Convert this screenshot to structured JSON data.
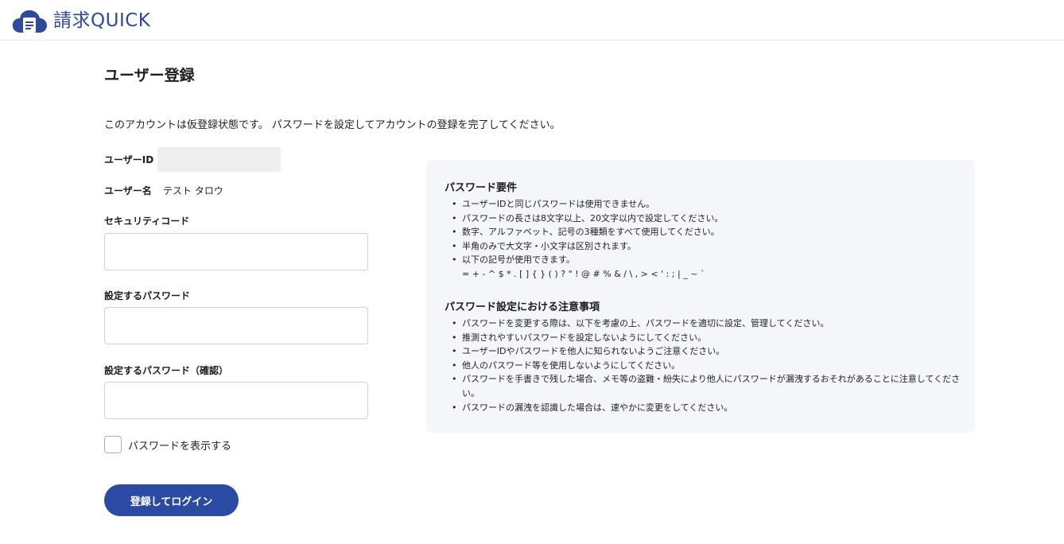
{
  "app": {
    "name": "請求QUICK"
  },
  "page": {
    "title": "ユーザー登録",
    "intro": "このアカウントは仮登録状態です。 パスワードを設定してアカウントの登録を完了してください。"
  },
  "form": {
    "user_id_label": "ユーザーID",
    "user_id_value": "",
    "user_name_label": "ユーザー名",
    "user_name_value": "テスト タロウ",
    "security_code_label": "セキュリティコード",
    "security_code_value": "",
    "password_label": "設定するパスワード",
    "password_value": "",
    "password_confirm_label": "設定するパスワード（確認）",
    "password_confirm_value": "",
    "show_password_label": "パスワードを表示する",
    "show_password_checked": false,
    "submit_label": "登録してログイン"
  },
  "requirements": {
    "heading": "パスワード要件",
    "items": [
      "ユーザーIDと同じパスワードは使用できません。",
      "パスワードの長さは8文字以上、20文字以内で設定してください。",
      "数字、アルファベット、記号の3種類をすべて使用してください。",
      "半角のみで大文字・小文字は区別されます。",
      "以下の記号が使用できます。"
    ],
    "symbols": "= + - ^ $ * . [ ] { } ( ) ? \" ! @ # % & / \\ , > < ' : ; | _ ~ `"
  },
  "cautions": {
    "heading": "パスワード設定における注意事項",
    "items": [
      "パスワードを変更する際は、以下を考慮の上、パスワードを適切に設定、管理してください。",
      "推測されやすいパスワードを設定しないようにしてください。",
      "ユーザーIDやパスワードを他人に知られないようご注意ください。",
      "他人のパスワード等を使用しないようにしてください。",
      "パスワードを手書きで残した場合、メモ等の盗難・紛失により他人にパスワードが漏洩するおそれがあることに注意してください。",
      "パスワードの漏洩を認識した場合は、速やかに変更をしてください。"
    ]
  },
  "colors": {
    "brand": "#2b4aa3",
    "panel_bg": "#f5f6fa",
    "input_border": "#cdd1d6"
  }
}
